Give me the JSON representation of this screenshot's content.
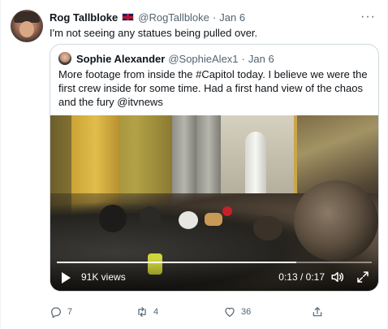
{
  "tweet": {
    "author_name": "Rog Tallbloke",
    "author_handle": "@RogTallbloke",
    "separator": "·",
    "time": "Jan 6",
    "more_icon": "more-icon",
    "text": "I'm not seeing any statues being pulled over."
  },
  "quote": {
    "author_name": "Sophie Alexander",
    "author_handle": "@SophieAlex1",
    "separator": "·",
    "time": "Jan 6",
    "text": "More footage from inside the #Capitol today. I believe we were the first crew inside for some time. Had a first hand view of the chaos and the fury @itvnews",
    "video": {
      "views": "91K views",
      "timecode": "0:13 / 0:17",
      "progress": 0.76,
      "play_icon": "play-icon",
      "volume_icon": "volume-icon",
      "fullscreen_icon": "fullscreen-icon"
    }
  },
  "actions": {
    "reply_count": "7",
    "retweet_count": "4",
    "like_count": "36",
    "reply_icon": "reply-icon",
    "retweet_icon": "retweet-icon",
    "like_icon": "like-icon",
    "share_icon": "share-icon"
  },
  "colors": {
    "text": "#0f1419",
    "secondary": "#536471",
    "border": "#cfd9de"
  }
}
